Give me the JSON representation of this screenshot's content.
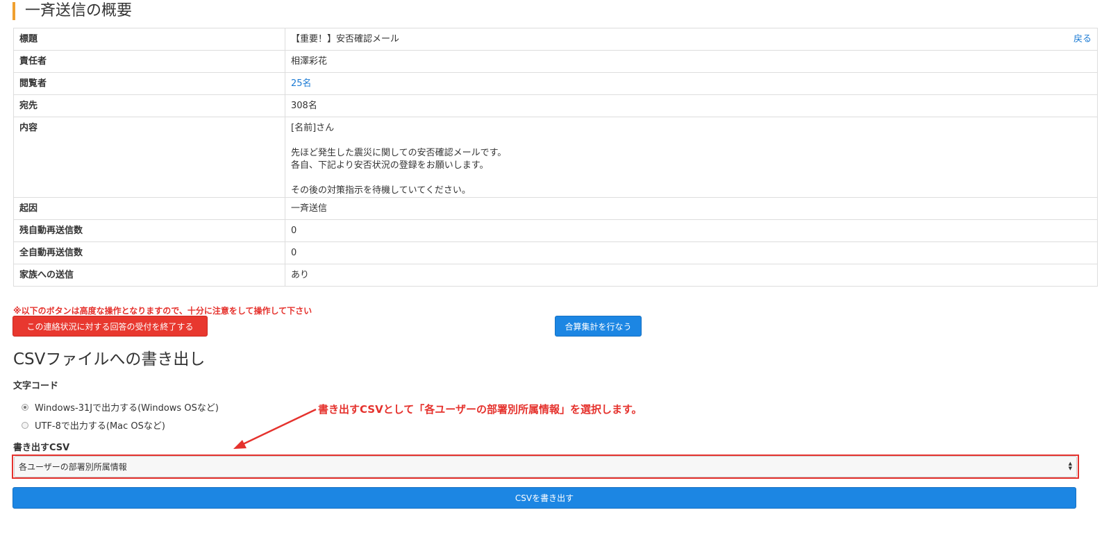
{
  "page": {
    "section_title": "一斉送信の概要"
  },
  "summary": {
    "rows": [
      {
        "key": "標題",
        "value": "【重要！】安否確認メール"
      },
      {
        "key": "責任者",
        "value": "相澤彩花"
      },
      {
        "key": "閲覧者",
        "value": "25名"
      },
      {
        "key": "宛先",
        "value": "308名"
      },
      {
        "key": "内容",
        "lines": [
          "[名前]さん",
          "",
          "先ほど発生した震災に関しての安否確認メールです。",
          "各自、下記より安否状況の登録をお願いします。",
          "",
          "その後の対策指示を待機していてください。"
        ]
      },
      {
        "key": "起因",
        "value": "一斉送信"
      },
      {
        "key": "残自動再送信数",
        "value": "0"
      },
      {
        "key": "全自動再送信数",
        "value": "0"
      },
      {
        "key": "家族への送信",
        "value": "あり"
      }
    ],
    "back_link": "戻る"
  },
  "actions": {
    "warning": "※以下のボタンは高度な操作となりますので、十分に注意をして操作して下さい",
    "end_accept_button": "この連絡状況に対する回答の受付を終了する",
    "aggregate_button": "合算集計を行なう"
  },
  "csv": {
    "heading": "CSVファイルへの書き出し",
    "charset_label": "文字コード",
    "options": [
      {
        "label": "Windows-31Jで出力する(Windows OSなど)",
        "checked": true
      },
      {
        "label": "UTF-8で出力する(Mac OSなど)",
        "checked": false
      }
    ],
    "csv_label": "書き出すCSV",
    "selected": "各ユーザーの部署別所属情報",
    "export_button": "CSVを書き出す"
  },
  "annotation": {
    "text": "書き出すCSVとして「各ユーザーの部署別所属情報」を選択します。",
    "color": "#e5322d"
  },
  "colors": {
    "accent_bar": "#f0a030",
    "danger": "#e8382f",
    "primary": "#1c86e3",
    "link": "#1a7ad4"
  }
}
